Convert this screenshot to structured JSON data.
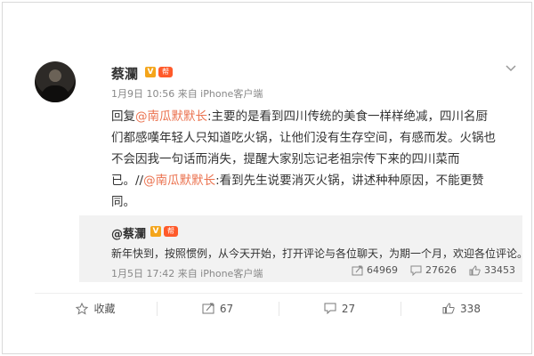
{
  "post": {
    "user": {
      "name": "蔡瀾",
      "v_badge": "V",
      "flag_badge": "帮"
    },
    "meta": "1月9日 10:56 来自 iPhone客户端",
    "text_parts": [
      {
        "text": "回复",
        "mention": false
      },
      {
        "text": "@南瓜默默长",
        "mention": true
      },
      {
        "text": ":主要的是看到四川传统的美食一样样绝减，四川名厨们都感嘆年轻人只知道吃火锅，让他们没有生存空间，有感而发。火锅也不会因我一句话而消失，提醒大家别忘记老祖宗传下来的四川菜而已。//",
        "mention": false
      },
      {
        "text": "@南瓜默默长",
        "mention": true
      },
      {
        "text": ":看到先生说要消灭火锅，讲述种种原因，不能更赞同。",
        "mention": false
      }
    ]
  },
  "quoted": {
    "user": "@蔡瀾",
    "v_badge": "V",
    "flag_badge": "帮",
    "text": "新年快到，按照惯例，从今天开始，打开评论与各位聊天，为期一个月，欢迎各位评论。",
    "meta": "1月5日 17:42 来自 iPhone客户端",
    "forward_count": "64969",
    "comment_count": "27626",
    "like_count": "33453"
  },
  "actions": {
    "favorite_label": "收藏",
    "forward_count": "67",
    "comment_count": "27",
    "like_count": "338"
  },
  "icons": {
    "chevron": "chevron-down-icon",
    "favorite": "star-icon",
    "forward": "forward-icon",
    "comment": "comment-icon",
    "like": "thumbs-up-icon"
  },
  "colors": {
    "mention": "#eb7350",
    "badge": "#f4a51b",
    "quote_bg": "#f2f2f2"
  }
}
